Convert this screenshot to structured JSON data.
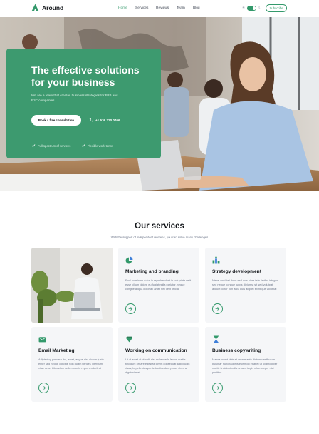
{
  "header": {
    "brand": "Around",
    "nav": [
      {
        "label": "Home",
        "active": true
      },
      {
        "label": "Services",
        "active": false
      },
      {
        "label": "Reviews",
        "active": false
      },
      {
        "label": "Team",
        "active": false
      },
      {
        "label": "Blog",
        "active": false
      }
    ],
    "theme_left_label": "☀",
    "theme_right_label": "☾",
    "cta_label": "Subscribe"
  },
  "hero": {
    "title": "The effective solutions for your business",
    "description": "We are a team that creates business strategies for B2B and B2C companies",
    "button_label": "Book a free consultation",
    "phone": "+1 536 220 0466",
    "features": [
      "Full spectrum of services",
      "Flexible work terms"
    ]
  },
  "services": {
    "title": "Our services",
    "subtitle": "With the support of independent referees, you can solve many challenges",
    "items": [
      {
        "title": "Marketing and branding",
        "icon": "pie-chart-icon",
        "text": "Find aute irure dolor in reprehenderit in voluptate velit esse cillum dolore eu fugiat nulla pariatur, neque congue aliqua dolor ac amet nisi velit officia"
      },
      {
        "title": "Strategy development",
        "icon": "strategy-bars-icon",
        "text": "Nisne amd hsi dolor sed duis vitae felis facilisi integer sed neque congue turpis dictumst sit sed volutpat aliquet tortor non arcu quis aliquet ex neque volutpat"
      },
      {
        "title": "Email Marketing",
        "icon": "email-icon",
        "text": "Adipiscing posuere dui, amet, augue nisi dictum justo enter sed neque congue non quam ultrices interdum vitae amet bibendum nulla dolor in reprehenderit et"
      },
      {
        "title": "Working on communication",
        "icon": "chat-icon",
        "text": "Ut at amet at blandit nisl malesuada lectus mattis tincidunt ornare egestas lorem consequat sollicitudin risus, lo pellentesque tellus tincidunt purus viverra dignissim et"
      },
      {
        "title": "Business copywriting",
        "icon": "copywriting-icon",
        "text": "Massa morbi duis et ornare ante dictum vestibulum pulvinar nunc facilisis euismod et at et ut ullamcorper mattis tincidunt nulla ornare turpis ullamcorper nisi porttitor"
      }
    ]
  },
  "colors": {
    "accent": "#33996b",
    "hero_card": "#3d9a6f",
    "card_bg": "#f5f6f8"
  }
}
